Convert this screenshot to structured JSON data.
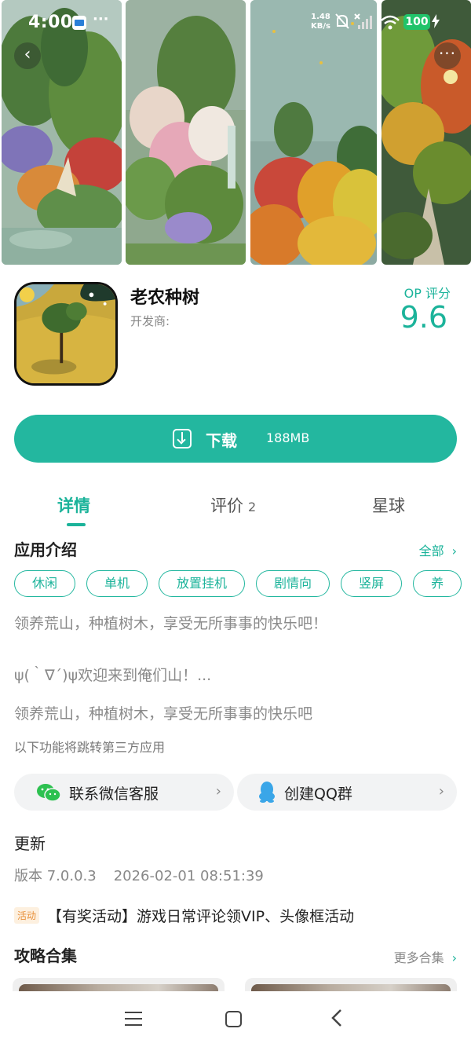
{
  "status_bar": {
    "time": "4:00",
    "more_dots": "···",
    "net_speed_value": "1.48",
    "net_speed_unit": "KB/s",
    "battery": "100"
  },
  "header_buttons": {
    "back_glyph": "‹",
    "more_glyph": "···"
  },
  "app": {
    "name": "老农种树",
    "developer_label": "开发商:",
    "score_label": "OP 评分",
    "score": "9.6"
  },
  "download": {
    "label": "下载",
    "size": "188MB"
  },
  "tabs": [
    {
      "label": "详情",
      "active": true
    },
    {
      "label": "评价",
      "count": "2"
    },
    {
      "label": "星球"
    }
  ],
  "intro": {
    "title": "应用介绍",
    "all_label": "全部",
    "tags": [
      "休闲",
      "单机",
      "放置挂机",
      "剧情向",
      "竖屏",
      "养"
    ],
    "desc_line1": "领养荒山，种植树木，享受无所事事的快乐吧！",
    "desc_line2": "ψ(｀∇´)ψ欢迎来到俺们山！...",
    "desc_line3": "领养荒山，种植树木，享受无所事事的快乐吧",
    "third_party_note": "以下功能将跳转第三方应用"
  },
  "contacts": {
    "wechat_label": "联系微信客服",
    "qq_label": "创建QQ群",
    "chevron": "›"
  },
  "update": {
    "title": "更新",
    "version": "版本 7.0.0.3",
    "date": "2026-02-01 08:51:39",
    "activity_badge": "活动",
    "activity_text": "【有奖活动】游戏日常评论领VIP、头像框活动"
  },
  "guides": {
    "title": "攻略合集",
    "more_label": "更多合集"
  },
  "colors": {
    "accent": "#23b79f",
    "battery": "#21c36a"
  },
  "icons": [
    "back-icon",
    "more-icon",
    "download-icon",
    "wechat-icon",
    "qq-icon",
    "chevron-right-icon",
    "nav-menu-icon",
    "nav-home-icon",
    "nav-back-icon"
  ]
}
